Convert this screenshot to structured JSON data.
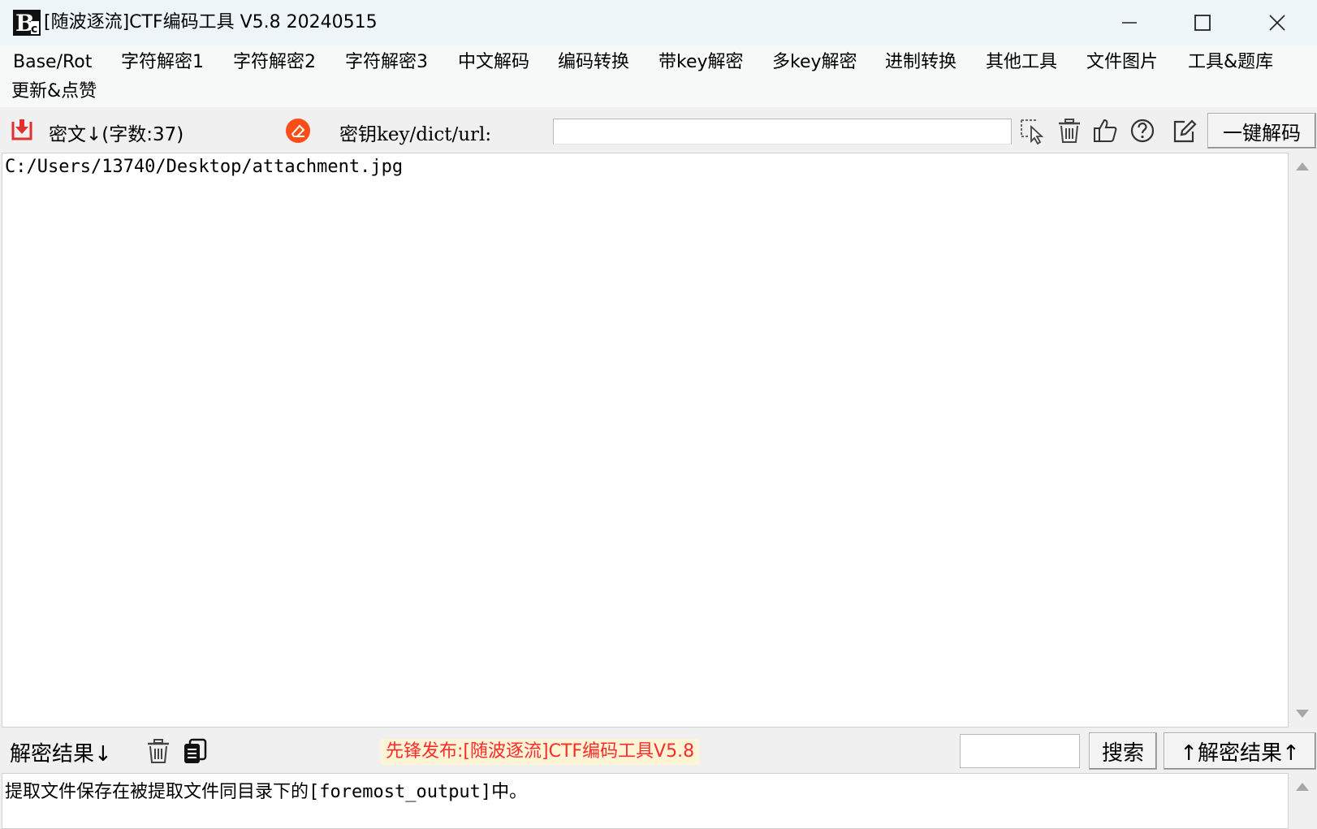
{
  "window": {
    "title": "[随波逐流]CTF编码工具 V5.8 20240515",
    "logo_text": "B",
    "controls": {
      "minimize": "—",
      "maximize": "☐",
      "close": "✕"
    }
  },
  "menu": {
    "items": [
      "Base/Rot",
      "字符解密1",
      "字符解密2",
      "字符解密3",
      "中文解码",
      "编码转换",
      "带key解密",
      "多key解密",
      "进制转换",
      "其他工具",
      "文件图片",
      "工具&题库"
    ],
    "second_row": [
      "更新&点赞"
    ]
  },
  "toolbar": {
    "cipher_label": "密文↓(字数:37)",
    "key_label": "密钥key/dict/url:",
    "key_value": "",
    "decode_button": "一键解码"
  },
  "cipher": {
    "text": "C:/Users/13740/Desktop/attachment.jpg"
  },
  "result_bar": {
    "label": "解密结果↓",
    "announcement": "先锋发布:[随波逐流]CTF编码工具V5.8",
    "search_value": "",
    "search_button": "搜索",
    "copy_up_button": "↑解密结果↑"
  },
  "result": {
    "text": "提取文件保存在被提取文件同目录下的[foremost_output]中。"
  },
  "colors": {
    "titlebar": "#eef5f8",
    "menubar": "#f7f8f8",
    "announcement_text": "#ff2a2a",
    "announcement_bg": "#fdf5d6",
    "eraser_icon": "#ff4d1a",
    "import_icon": "#e03030"
  }
}
